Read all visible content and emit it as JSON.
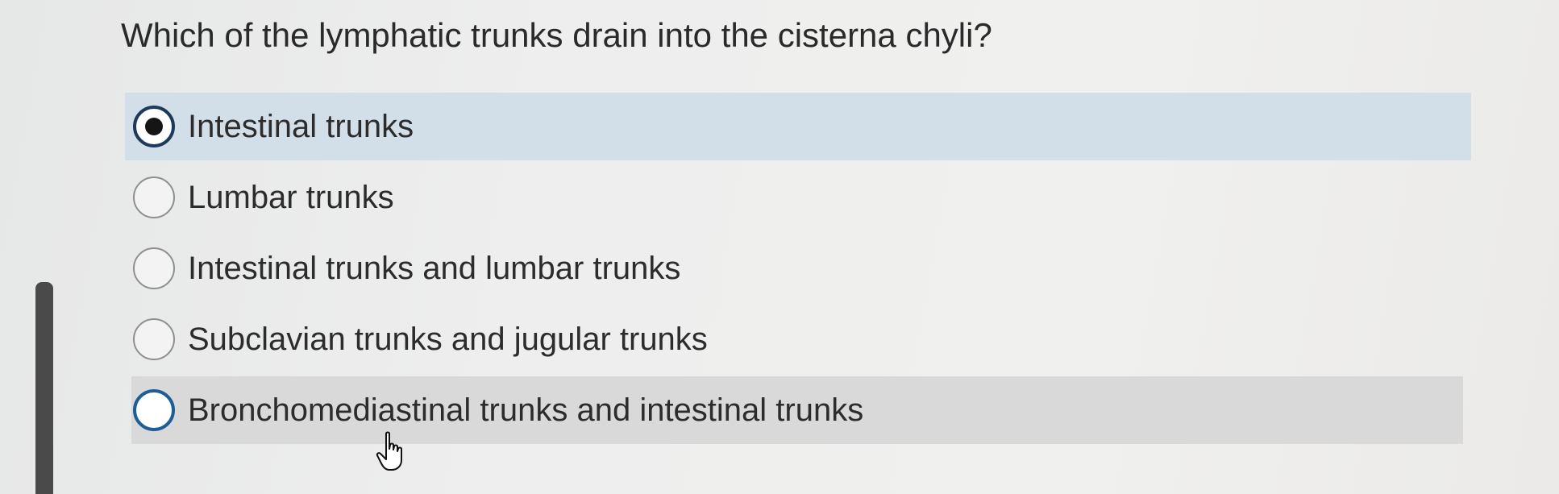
{
  "question": {
    "text": "Which of the lymphatic trunks drain into the cisterna chyli?"
  },
  "options": [
    {
      "label": "Intestinal trunks",
      "selected": true
    },
    {
      "label": "Lumbar trunks",
      "selected": false
    },
    {
      "label": "Intestinal trunks and lumbar trunks",
      "selected": false
    },
    {
      "label": "Subclavian trunks and jugular trunks",
      "selected": false
    },
    {
      "label": "Bronchomediastinal trunks and intestinal trunks",
      "selected": false,
      "hovered": true
    }
  ],
  "colors": {
    "selected_highlight": "#d3dfe8",
    "hover_highlight": "#d9d9d9",
    "focus_ring": "#1f5d98"
  },
  "icons": {
    "cursor": "hand-pointer-icon"
  }
}
